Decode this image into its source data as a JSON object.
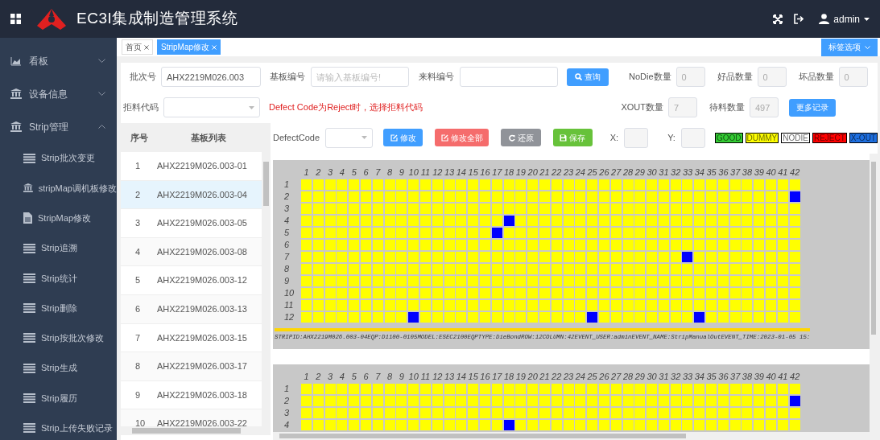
{
  "header": {
    "title": "EC3I集成制造管理系统",
    "user": "admin"
  },
  "sidebar": {
    "items": [
      {
        "kind": "chart",
        "label": "看板",
        "expanded": false
      },
      {
        "kind": "bank",
        "label": "设备信息",
        "expanded": false
      },
      {
        "kind": "bank",
        "label": "Strip管理",
        "expanded": true,
        "children": [
          {
            "kind": "list",
            "label": "Strip批次变更"
          },
          {
            "kind": "bank",
            "label": "stripMap调机板修改"
          },
          {
            "kind": "file",
            "label": "StripMap修改"
          },
          {
            "kind": "list",
            "label": "Strip追溯"
          },
          {
            "kind": "list",
            "label": "Strip统计"
          },
          {
            "kind": "list",
            "label": "Strip删除"
          },
          {
            "kind": "list",
            "label": "Strip按批次修改"
          },
          {
            "kind": "list",
            "label": "Strip生成"
          },
          {
            "kind": "list",
            "label": "Strip履历"
          },
          {
            "kind": "list",
            "label": "Strip上传失败记录"
          }
        ]
      }
    ]
  },
  "tabs": [
    {
      "label": "首页",
      "selected": false
    },
    {
      "label": "StripMap修改",
      "selected": true
    }
  ],
  "tab_options": "标签选项",
  "form": {
    "lot_label": "批次号",
    "lot_value": "AHX2219M026.003",
    "board_label": "基板编号",
    "board_placeholder": "请输入基板编号!",
    "material_label": "来料编号",
    "query_button": "查询",
    "counts_row1": [
      {
        "label": "NoDie数量",
        "value": "0"
      },
      {
        "label": "好品数量",
        "value": "0"
      },
      {
        "label": "坏品数量",
        "value": "0"
      }
    ],
    "reject_label": "拒料代码",
    "reject_note": "Defect Code为Reject时，选择拒料代码",
    "counts_row2": [
      {
        "label": "XOUT数量",
        "value": "7"
      },
      {
        "label": "待料数量",
        "value": "497"
      }
    ],
    "more_button": "更多记录"
  },
  "board_list": {
    "columns": [
      "序号",
      "基板列表"
    ],
    "rows": [
      {
        "no": "1",
        "board": "AHX2219M026.003-01",
        "selected": false
      },
      {
        "no": "2",
        "board": "AHX2219M026.003-04",
        "selected": true
      },
      {
        "no": "3",
        "board": "AHX2219M026.003-05",
        "selected": false
      },
      {
        "no": "4",
        "board": "AHX2219M026.003-08",
        "selected": false
      },
      {
        "no": "5",
        "board": "AHX2219M026.003-12",
        "selected": false
      },
      {
        "no": "6",
        "board": "AHX2219M026.003-13",
        "selected": false
      },
      {
        "no": "7",
        "board": "AHX2219M026.003-15",
        "selected": false
      },
      {
        "no": "8",
        "board": "AHX2219M026.003-17",
        "selected": false
      },
      {
        "no": "9",
        "board": "AHX2219M026.003-18",
        "selected": false
      },
      {
        "no": "10",
        "board": "AHX2219M026.003-22",
        "selected": false
      }
    ]
  },
  "toolbar": {
    "defect_label": "DefectCode",
    "buttons": [
      {
        "kind": "edit",
        "label": "修改"
      },
      {
        "kind": "edit_all",
        "label": "修改全部"
      },
      {
        "kind": "restore",
        "label": "还原"
      },
      {
        "kind": "save",
        "label": "保存"
      }
    ],
    "x_label": "X:",
    "y_label": "Y:",
    "legend": [
      {
        "label": "GOOD",
        "color": "#33cc33"
      },
      {
        "label": "DUMMY",
        "color": "#ffff00"
      },
      {
        "label": "NODIE",
        "color": "#ffffff"
      },
      {
        "label": "REJECT",
        "color": "#ff0000"
      },
      {
        "label": "X-OUT",
        "color": "#1e6fe0"
      }
    ]
  },
  "strip_maps": [
    {
      "column_labels": [
        "1",
        "2",
        "3",
        "4",
        "5",
        "6",
        "7",
        "8",
        "9",
        "10",
        "11",
        "12",
        "13",
        "14",
        "15",
        "16",
        "17",
        "18",
        "19",
        "20",
        "21",
        "22",
        "23",
        "24",
        "25",
        "26",
        "27",
        "28",
        "29",
        "30",
        "31",
        "32",
        "33",
        "34",
        "35",
        "36",
        "37",
        "38",
        "39",
        "40",
        "41",
        "42"
      ],
      "rows": [
        {
          "label": "1",
          "xout": [
            false,
            false,
            false,
            false,
            false,
            false,
            false,
            false,
            false,
            false,
            false,
            false,
            false,
            false,
            false,
            false,
            false,
            false,
            false,
            false,
            false,
            false,
            false,
            false,
            false,
            false,
            false,
            false,
            false,
            false,
            false,
            false,
            false,
            false,
            false,
            false,
            false,
            false,
            false,
            false,
            false,
            false
          ]
        },
        {
          "label": "2",
          "xout": [
            false,
            false,
            false,
            false,
            false,
            false,
            false,
            false,
            false,
            false,
            false,
            false,
            false,
            false,
            false,
            false,
            false,
            false,
            false,
            false,
            false,
            false,
            false,
            false,
            false,
            false,
            false,
            false,
            false,
            false,
            false,
            false,
            false,
            false,
            false,
            false,
            false,
            false,
            false,
            false,
            false,
            true
          ]
        },
        {
          "label": "3",
          "xout": [
            false,
            false,
            false,
            false,
            false,
            false,
            false,
            false,
            false,
            false,
            false,
            false,
            false,
            false,
            false,
            false,
            false,
            false,
            false,
            false,
            false,
            false,
            false,
            false,
            false,
            false,
            false,
            false,
            false,
            false,
            false,
            false,
            false,
            false,
            false,
            false,
            false,
            false,
            false,
            false,
            false,
            false
          ]
        },
        {
          "label": "4",
          "xout": [
            false,
            false,
            false,
            false,
            false,
            false,
            false,
            false,
            false,
            false,
            false,
            false,
            false,
            false,
            false,
            false,
            false,
            true,
            false,
            false,
            false,
            false,
            false,
            false,
            false,
            false,
            false,
            false,
            false,
            false,
            false,
            false,
            false,
            false,
            false,
            false,
            false,
            false,
            false,
            false,
            false,
            false
          ]
        },
        {
          "label": "5",
          "xout": [
            false,
            false,
            false,
            false,
            false,
            false,
            false,
            false,
            false,
            false,
            false,
            false,
            false,
            false,
            false,
            false,
            true,
            false,
            false,
            false,
            false,
            false,
            false,
            false,
            false,
            false,
            false,
            false,
            false,
            false,
            false,
            false,
            false,
            false,
            false,
            false,
            false,
            false,
            false,
            false,
            false,
            false
          ]
        },
        {
          "label": "6",
          "xout": [
            false,
            false,
            false,
            false,
            false,
            false,
            false,
            false,
            false,
            false,
            false,
            false,
            false,
            false,
            false,
            false,
            false,
            false,
            false,
            false,
            false,
            false,
            false,
            false,
            false,
            false,
            false,
            false,
            false,
            false,
            false,
            false,
            false,
            false,
            false,
            false,
            false,
            false,
            false,
            false,
            false,
            false
          ]
        },
        {
          "label": "7",
          "xout": [
            false,
            false,
            false,
            false,
            false,
            false,
            false,
            false,
            false,
            false,
            false,
            false,
            false,
            false,
            false,
            false,
            false,
            false,
            false,
            false,
            false,
            false,
            false,
            false,
            false,
            false,
            false,
            false,
            false,
            false,
            false,
            false,
            true,
            false,
            false,
            false,
            false,
            false,
            false,
            false,
            false,
            false
          ]
        },
        {
          "label": "8",
          "xout": [
            false,
            false,
            false,
            false,
            false,
            false,
            false,
            false,
            false,
            false,
            false,
            false,
            false,
            false,
            false,
            false,
            false,
            false,
            false,
            false,
            false,
            false,
            false,
            false,
            false,
            false,
            false,
            false,
            false,
            false,
            false,
            false,
            false,
            false,
            false,
            false,
            false,
            false,
            false,
            false,
            false,
            false
          ]
        },
        {
          "label": "9",
          "xout": [
            false,
            false,
            false,
            false,
            false,
            false,
            false,
            false,
            false,
            false,
            false,
            false,
            false,
            false,
            false,
            false,
            false,
            false,
            false,
            false,
            false,
            false,
            false,
            false,
            false,
            false,
            false,
            false,
            false,
            false,
            false,
            false,
            false,
            false,
            false,
            false,
            false,
            false,
            false,
            false,
            false,
            false
          ]
        },
        {
          "label": "10",
          "xout": [
            false,
            false,
            false,
            false,
            false,
            false,
            false,
            false,
            false,
            false,
            false,
            false,
            false,
            false,
            false,
            false,
            false,
            false,
            false,
            false,
            false,
            false,
            false,
            false,
            false,
            false,
            false,
            false,
            false,
            false,
            false,
            false,
            false,
            false,
            false,
            false,
            false,
            false,
            false,
            false,
            false,
            false
          ]
        },
        {
          "label": "11",
          "xout": [
            false,
            false,
            false,
            false,
            false,
            false,
            false,
            false,
            false,
            false,
            false,
            false,
            false,
            false,
            false,
            false,
            false,
            false,
            false,
            false,
            false,
            false,
            false,
            false,
            false,
            false,
            false,
            false,
            false,
            false,
            false,
            false,
            false,
            false,
            false,
            false,
            false,
            false,
            false,
            false,
            false,
            false
          ]
        },
        {
          "label": "12",
          "xout": [
            false,
            false,
            false,
            false,
            false,
            false,
            false,
            false,
            false,
            true,
            false,
            false,
            false,
            false,
            false,
            false,
            false,
            false,
            false,
            false,
            false,
            false,
            false,
            false,
            true,
            false,
            false,
            false,
            false,
            false,
            false,
            false,
            false,
            true,
            false,
            false,
            false,
            false,
            false,
            false,
            false,
            false
          ]
        }
      ],
      "info": "STRIPID:AHX2219M026.003-04EQP:D1100-0105MODEL:ESEC2100EQPTYPE:DieBondROW:12COLUMN:42EVENT_USER:adminEVENT_NAME:StripManualOutEVENT_TIME:2023-01-05 15:"
    },
    {
      "column_labels": [
        "1",
        "2",
        "3",
        "4",
        "5",
        "6",
        "7",
        "8",
        "9",
        "10",
        "11",
        "12",
        "13",
        "14",
        "15",
        "16",
        "17",
        "18",
        "19",
        "20",
        "21",
        "22",
        "23",
        "24",
        "25",
        "26",
        "27",
        "28",
        "29",
        "30",
        "31",
        "32",
        "33",
        "34",
        "35",
        "36",
        "37",
        "38",
        "39",
        "40",
        "41",
        "42"
      ],
      "rows": [
        {
          "label": "1",
          "xout": [
            false,
            false,
            false,
            false,
            false,
            false,
            false,
            false,
            false,
            false,
            false,
            false,
            false,
            false,
            false,
            false,
            false,
            false,
            false,
            false,
            false,
            false,
            false,
            false,
            false,
            false,
            false,
            false,
            false,
            false,
            false,
            false,
            false,
            false,
            false,
            false,
            false,
            false,
            false,
            false,
            false,
            false
          ]
        },
        {
          "label": "2",
          "xout": [
            false,
            false,
            false,
            false,
            false,
            false,
            false,
            false,
            false,
            false,
            false,
            false,
            false,
            false,
            false,
            false,
            false,
            false,
            false,
            false,
            false,
            false,
            false,
            false,
            false,
            false,
            false,
            false,
            false,
            false,
            false,
            false,
            false,
            false,
            false,
            false,
            false,
            false,
            false,
            false,
            false,
            true
          ]
        },
        {
          "label": "3",
          "xout": [
            false,
            false,
            false,
            false,
            false,
            false,
            false,
            false,
            false,
            false,
            false,
            false,
            false,
            false,
            false,
            false,
            false,
            false,
            false,
            false,
            false,
            false,
            false,
            false,
            false,
            false,
            false,
            false,
            false,
            false,
            false,
            false,
            false,
            false,
            false,
            false,
            false,
            false,
            false,
            false,
            false,
            false
          ]
        },
        {
          "label": "4",
          "xout": [
            false,
            false,
            false,
            false,
            false,
            false,
            false,
            false,
            false,
            false,
            false,
            false,
            false,
            false,
            false,
            false,
            false,
            true,
            false,
            false,
            false,
            false,
            false,
            false,
            false,
            false,
            false,
            false,
            false,
            false,
            false,
            false,
            false,
            false,
            false,
            false,
            false,
            false,
            false,
            false,
            false,
            false
          ]
        }
      ]
    }
  ]
}
